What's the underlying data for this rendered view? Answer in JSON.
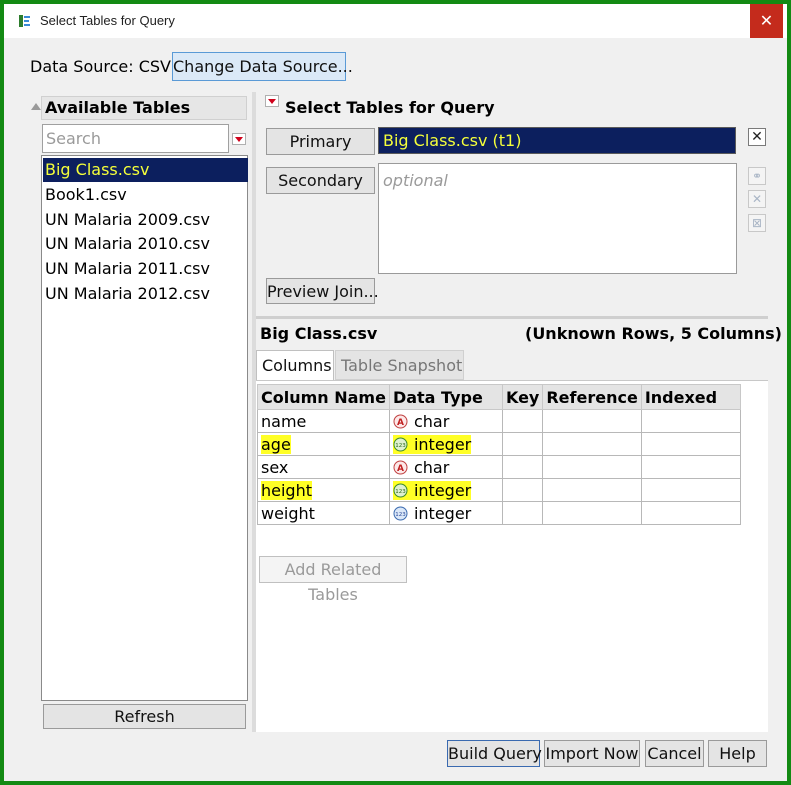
{
  "window": {
    "title": "Select Tables for Query"
  },
  "source": {
    "label": "Data Source: CSV",
    "change_button": "Change Data Source..."
  },
  "left": {
    "header": "Available Tables",
    "search_placeholder": "Search",
    "tables": [
      "Big Class.csv",
      "Book1.csv",
      "UN Malaria 2009.csv",
      "UN Malaria 2010.csv",
      "UN Malaria 2011.csv",
      "UN Malaria 2012.csv"
    ],
    "selected_index": 0,
    "refresh_button": "Refresh"
  },
  "query": {
    "header": "Select Tables for Query",
    "primary_button": "Primary",
    "primary_value": "Big Class.csv (t1)",
    "secondary_button": "Secondary",
    "secondary_placeholder": "optional",
    "preview_button": "Preview Join..."
  },
  "details": {
    "table_name": "Big Class.csv",
    "summary": "(Unknown Rows, 5 Columns)",
    "tabs": [
      "Columns",
      "Table Snapshot"
    ],
    "active_tab": 0,
    "columns_header": [
      "Column Name",
      "Data Type",
      "Key",
      "Reference",
      "Indexed"
    ],
    "rows": [
      {
        "name": "name",
        "type": "char",
        "icon": "char-icon",
        "highlight": false
      },
      {
        "name": "age",
        "type": "integer",
        "icon": "integer-icon",
        "highlight": true
      },
      {
        "name": "sex",
        "type": "char",
        "icon": "char-icon",
        "highlight": false
      },
      {
        "name": "height",
        "type": "integer",
        "icon": "integer-icon",
        "highlight": true
      },
      {
        "name": "weight",
        "type": "integer",
        "icon": "integer-icon",
        "highlight": false
      }
    ],
    "add_related_button": "Add Related Tables"
  },
  "footer": {
    "build": "Build Query",
    "import": "Import Now",
    "cancel": "Cancel",
    "help": "Help"
  },
  "colors": {
    "frame": "#138a13",
    "selection_bg": "#0c1f5e",
    "selection_text": "#f5ff3a",
    "highlight": "#ffff00",
    "close": "#c42b1c"
  }
}
